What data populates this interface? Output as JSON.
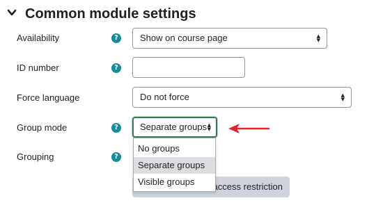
{
  "section": {
    "title": "Common module settings"
  },
  "fields": {
    "availability": {
      "label": "Availability",
      "value": "Show on course page"
    },
    "id_number": {
      "label": "ID number",
      "value": ""
    },
    "force_language": {
      "label": "Force language",
      "value": "Do not force"
    },
    "group_mode": {
      "label": "Group mode",
      "value": "Separate groups",
      "options": [
        "No groups",
        "Separate groups",
        "Visible groups"
      ]
    },
    "grouping": {
      "label": "Grouping"
    }
  },
  "restriction_button": {
    "label": "g access restriction"
  },
  "icons": {
    "help": "?",
    "caret": "▲▼",
    "chevron": "chevron-down-icon",
    "arrow": "annotation-arrow-icon"
  },
  "colors": {
    "help_icon": "#1a8a9a",
    "focus_border": "#3a7a52",
    "arrow": "#d9272e",
    "selected_option": "#dcdde0"
  }
}
